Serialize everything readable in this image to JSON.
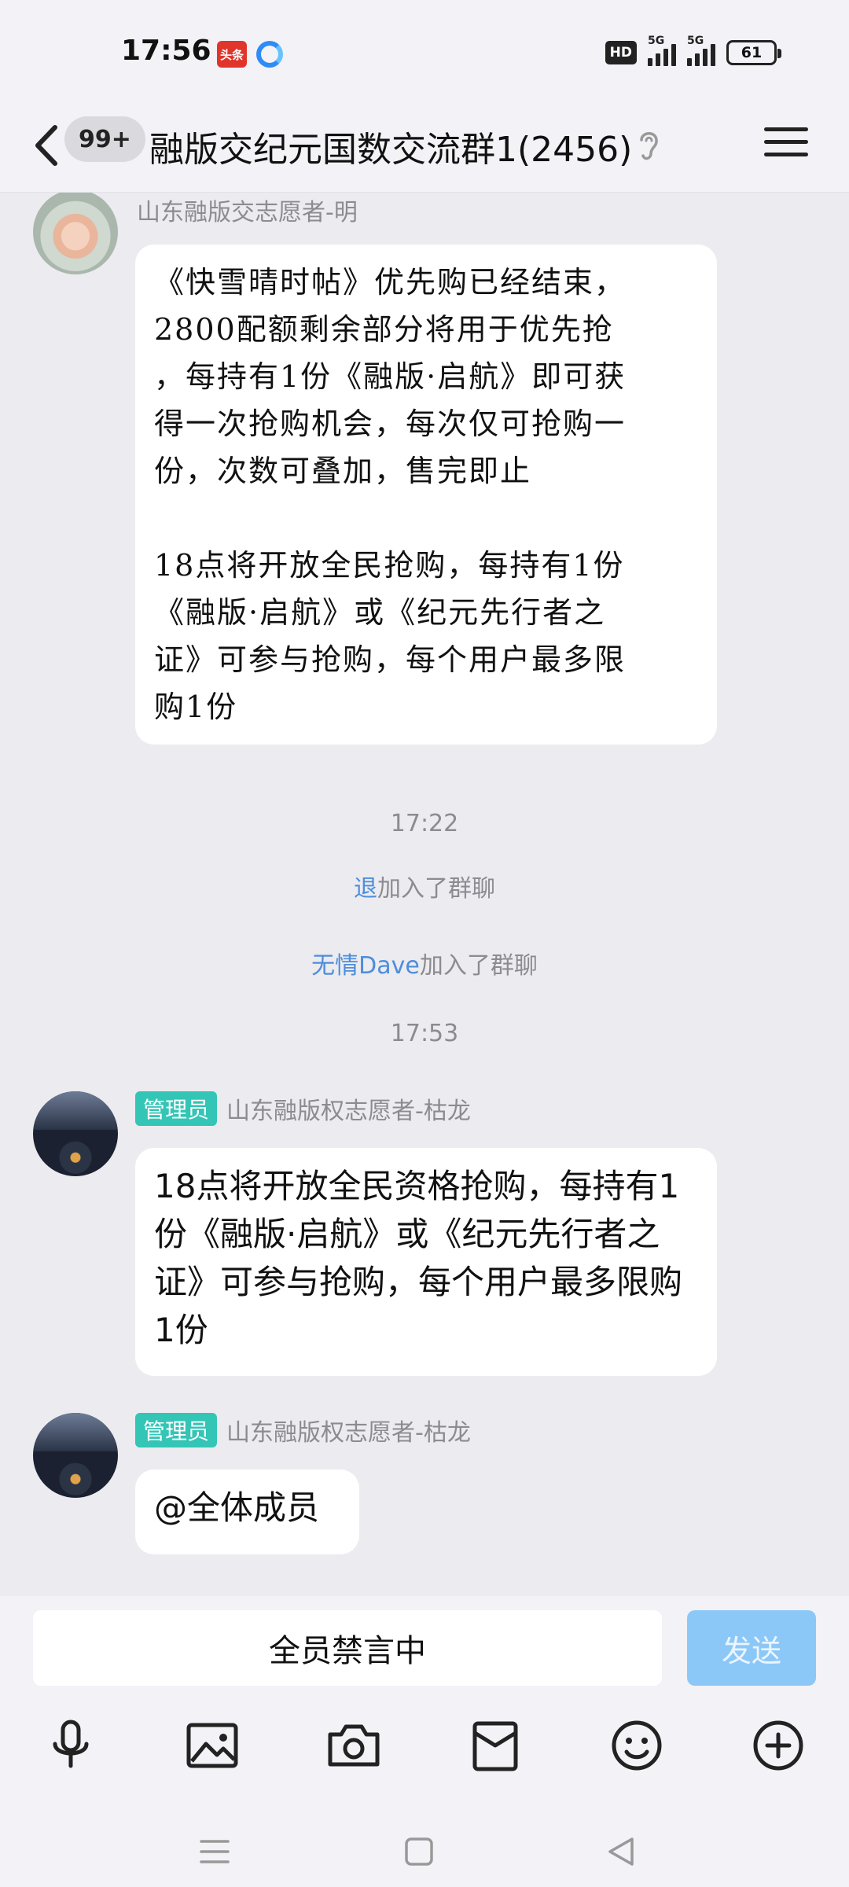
{
  "status_bar": {
    "time": "17:56",
    "toutiao_label": "头条",
    "hd_label": "HD",
    "signal1_label": "5G",
    "signal2_label": "5G",
    "battery": "61"
  },
  "header": {
    "unread_count": "99+",
    "title": "融版交纪元国数交流群1(2456)"
  },
  "messages": [
    {
      "sender": "山东融版交志愿者-明",
      "text": "《快雪晴时帖》优先购已经结束，\n2800配额剩余部分将用于优先抢\n，每持有1份《融版·启航》即可获\n得一次抢购机会，每次仅可抢购一\n份，次数可叠加，售完即止\n\n18点将开放全民抢购，每持有1份\n《融版·启航》或《纪元先行者之\n证》可参与抢购，每个用户最多限\n购1份"
    },
    {
      "badge": "管理员",
      "sender": "山东融版权志愿者-枯龙",
      "text": "18点将开放全民资格抢购，每持有1份《融版·启航》或《纪元先行者之证》可参与抢购，每个用户最多限购1份"
    },
    {
      "badge": "管理员",
      "sender": "山东融版权志愿者-枯龙",
      "text": "@全体成员"
    }
  ],
  "system": {
    "time1": "17:22",
    "join1_name": "退",
    "join1_suffix": "加入了群聊",
    "join2_name": "无情Dave",
    "join2_suffix": "加入了群聊",
    "time2": "17:53"
  },
  "input": {
    "muted_text": "全员禁言中",
    "send_label": "发送"
  },
  "icons": {
    "toolbar": [
      "microphone-icon",
      "image-icon",
      "camera-icon",
      "red-packet-icon",
      "emoji-icon",
      "plus-icon"
    ],
    "nav": [
      "menu-nav-icon",
      "home-nav-icon",
      "back-nav-icon"
    ]
  },
  "colors": {
    "admin_badge": "#33c5b5",
    "link_name": "#4e8ddb",
    "send_button": "#8cc8f7"
  }
}
